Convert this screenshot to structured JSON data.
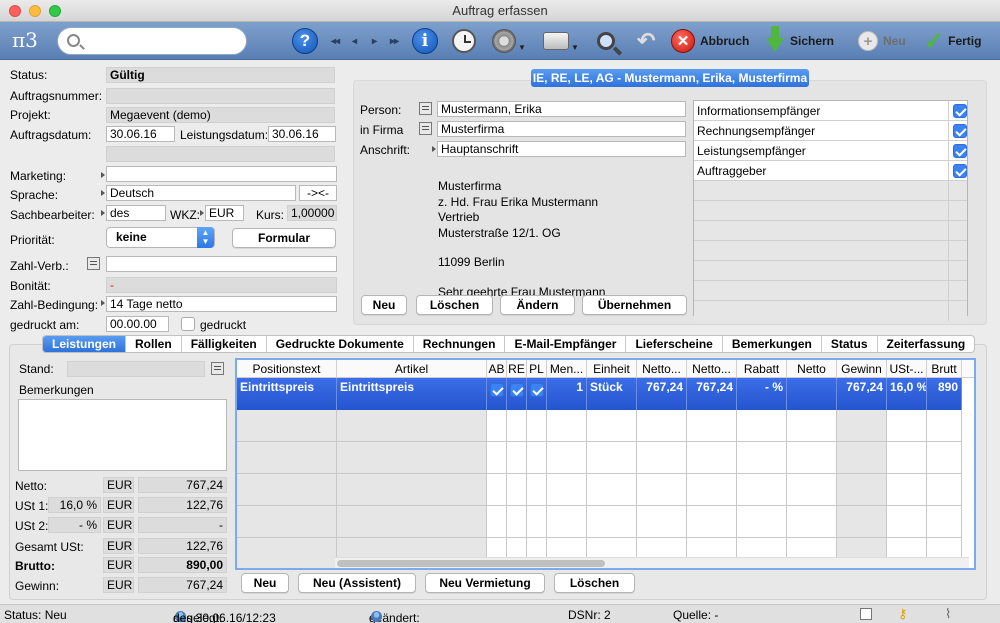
{
  "window": {
    "title": "Auftrag erfassen"
  },
  "toolbar": {
    "logo": "π3",
    "search_placeholder": "",
    "abort": "Abbruch",
    "save": "Sichern",
    "new": "Neu",
    "done": "Fertig"
  },
  "form": {
    "status_label": "Status:",
    "status_value": "Gültig",
    "order_no_label": "Auftragsnummer:",
    "order_no_value": "",
    "project_label": "Projekt:",
    "project_value": "Megaevent (demo)",
    "order_date_label": "Auftragsdatum:",
    "order_date_value": "30.06.16",
    "service_date_label": "Leistungsdatum:",
    "service_date_value": "30.06.16",
    "marketing_label": "Marketing:",
    "marketing_value": "",
    "language_label": "Sprache:",
    "language_value": "Deutsch",
    "swap_button": "->'<-",
    "clerk_label": "Sachbearbeiter:",
    "clerk_value": "des",
    "currency_label": "WKZ:",
    "currency_value": "EUR",
    "rate_label": "Kurs:",
    "rate_value": "1,00000",
    "priority_label": "Priorität:",
    "priority_value": "keine",
    "form_button": "Formular",
    "payment_label": "Zahl-Verb.:",
    "payment_value": "",
    "credit_label": "Bonität:",
    "credit_value": "-",
    "payment_terms_label": "Zahl-Bedingung:",
    "payment_terms_value": "14 Tage netto",
    "printed_label": "gedruckt am:",
    "printed_value": "00.00.00",
    "printed_checkbox": "gedruckt"
  },
  "contact": {
    "header": "IE, RE, LE, AG - Mustermann, Erika, Musterfirma",
    "person_label": "Person:",
    "person_value": "Mustermann, Erika",
    "company_label": "in Firma",
    "company_value": "Musterfirma",
    "address_label": "Anschrift:",
    "address_value": "Hauptanschrift",
    "address_lines": [
      "Musterfirma",
      "z. Hd. Frau Erika Mustermann",
      "Vertrieb",
      "Musterstraße 12/1. OG",
      "",
      "11099 Berlin",
      "",
      "Sehr geehrte Frau Mustermann"
    ],
    "buttons": {
      "new": "Neu",
      "delete": "Löschen",
      "change": "Ändern",
      "apply": "Übernehmen"
    },
    "roles": [
      {
        "label": "Informationsempfänger",
        "checked": true
      },
      {
        "label": "Rechnungsempfänger",
        "checked": true
      },
      {
        "label": "Leistungsempfänger",
        "checked": true
      },
      {
        "label": "Auftraggeber",
        "checked": true
      }
    ]
  },
  "tabs": [
    "Leistungen",
    "Rollen",
    "Fälligkeiten",
    "Gedruckte Dokumente",
    "Rechnungen",
    "E-Mail-Empfänger",
    "Lieferscheine",
    "Bemerkungen",
    "Status",
    "Zeiterfassung"
  ],
  "leistungen": {
    "stand_label": "Stand:",
    "stand_value": "",
    "remarks_label": "Bemerkungen",
    "totals": {
      "netto_label": "Netto:",
      "netto_cur": "EUR",
      "netto_value": "767,24",
      "ust1_label": "USt 1:",
      "ust1_pct": "16,0 %",
      "ust1_cur": "EUR",
      "ust1_value": "122,76",
      "ust2_label": "USt 2:",
      "ust2_pct": "- %",
      "ust2_cur": "EUR",
      "ust2_value": "-",
      "gesamt_label": "Gesamt USt:",
      "gesamt_cur": "EUR",
      "gesamt_value": "122,76",
      "brutto_label": "Brutto:",
      "brutto_cur": "EUR",
      "brutto_value": "890,00",
      "gewinn_label": "Gewinn:",
      "gewinn_cur": "EUR",
      "gewinn_value": "767,24"
    },
    "columns": [
      "Positionstext",
      "Artikel",
      "AB",
      "RE",
      "PL",
      "Men...",
      "Einheit",
      "Netto...",
      "Netto...",
      "Rabatt",
      "Netto",
      "Gewinn",
      "USt-...",
      "Brutt"
    ],
    "row": {
      "positionstext": "Eintrittspreis",
      "artikel": "Eintrittspreis",
      "ab": true,
      "re": true,
      "pl": true,
      "menge": "1",
      "einheit": "Stück",
      "netto_e": "767,24",
      "netto_g": "767,24",
      "rabatt": "- %",
      "netto": "",
      "gewinn": "767,24",
      "ust": "16,0 %",
      "brutto": "890"
    },
    "buttons": {
      "new": "Neu",
      "new_wizard": "Neu (Assistent)",
      "new_rental": "Neu Vermietung",
      "delete": "Löschen"
    }
  },
  "statusbar": {
    "status": "Status:  Neu",
    "created_label": "angelegt:",
    "created_value": "des 30.06.16/12:23",
    "changed_label": "geändert:",
    "changed_value": "-",
    "dsnr": "DSNr: 2",
    "source": "Quelle: -"
  }
}
